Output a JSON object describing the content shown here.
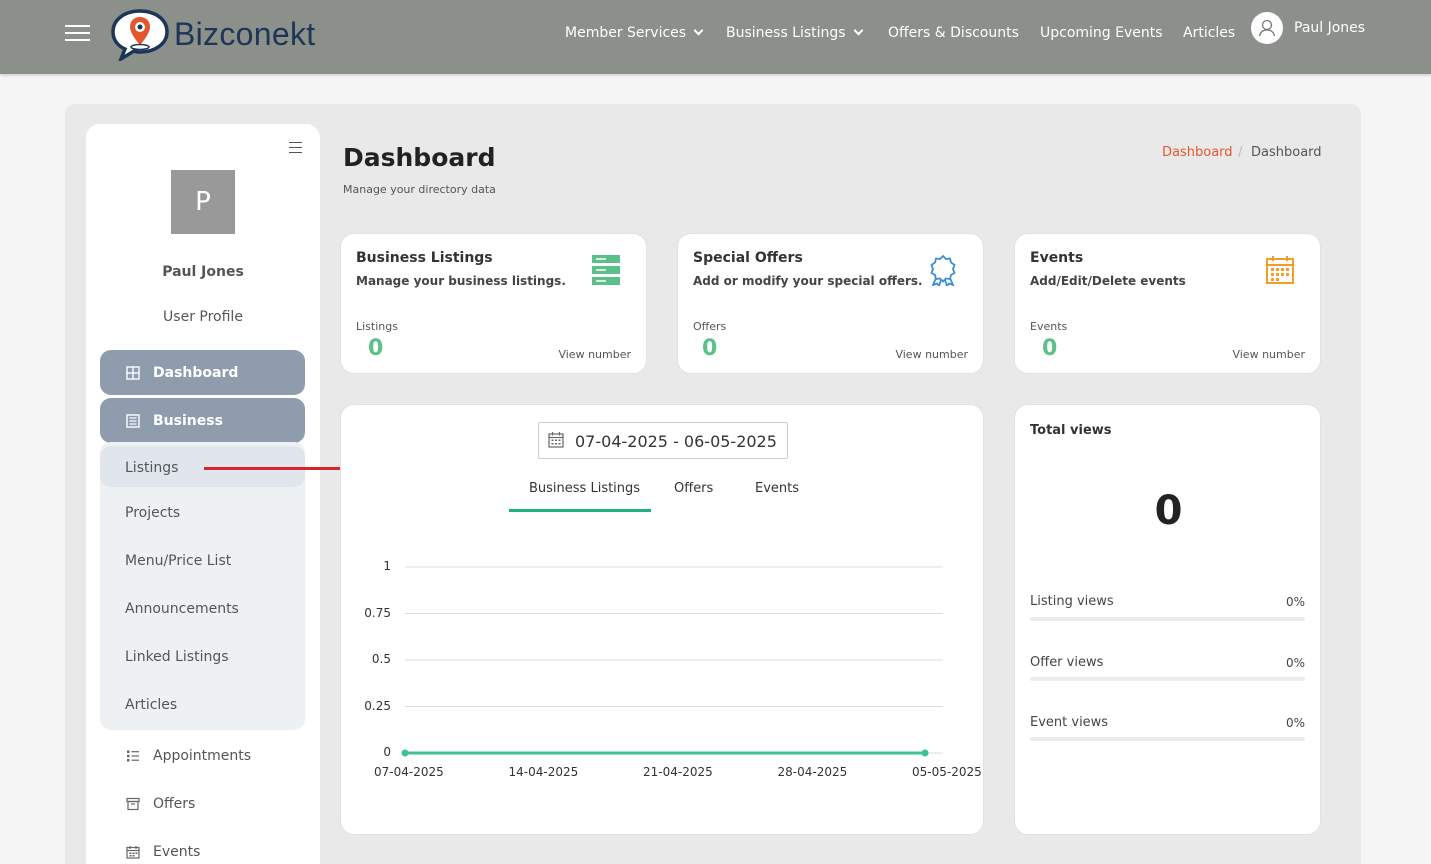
{
  "header": {
    "logo_text": "Bizconekt",
    "nav": [
      {
        "label": "Member Services",
        "dropdown": true
      },
      {
        "label": "Business Listings",
        "dropdown": true
      },
      {
        "label": "Offers & Discounts",
        "dropdown": false
      },
      {
        "label": "Upcoming Events",
        "dropdown": false
      },
      {
        "label": "Articles",
        "dropdown": false
      }
    ],
    "user_name": "Paul Jones",
    "icons": {
      "menu": "hamburger-icon",
      "user": "user-icon",
      "logo": "chat-location-pin-logo"
    }
  },
  "sidebar": {
    "avatar_letter": "P",
    "user_name": "Paul Jones",
    "profile_link": "User Profile",
    "dashboard_btn": "Dashboard",
    "business_btn": "Business",
    "business_submenu": [
      "Listings",
      "Projects",
      "Menu/Price List",
      "Announcements",
      "Linked Listings",
      "Articles"
    ],
    "active_submenu": "Listings",
    "links": [
      {
        "label": "Appointments",
        "icon": "list-icon"
      },
      {
        "label": "Offers",
        "icon": "archive-icon"
      },
      {
        "label": "Events",
        "icon": "calendar-icon"
      }
    ]
  },
  "page": {
    "title": "Dashboard",
    "subtitle": "Manage your directory data",
    "breadcrumb": {
      "link": "Dashboard",
      "separator": "/",
      "current": "Dashboard"
    }
  },
  "cards": [
    {
      "title": "Business Listings",
      "description": "Manage your business listings.",
      "label": "Listings",
      "value": "0",
      "view": "View number",
      "icon": "server-icon",
      "icon_color": "#5bc08a"
    },
    {
      "title": "Special Offers",
      "description": "Add or modify your special offers.",
      "label": "Offers",
      "value": "0",
      "view": "View number",
      "icon": "award-icon",
      "icon_color": "#3d8fd6"
    },
    {
      "title": "Events",
      "description": "Add/Edit/Delete events",
      "label": "Events",
      "value": "0",
      "view": "View number",
      "icon": "calendar-icon",
      "icon_color": "#f39c26"
    }
  ],
  "chart_panel": {
    "date_range": "07-04-2025 - 06-05-2025",
    "tabs": [
      "Business Listings",
      "Offers",
      "Events"
    ],
    "active_tab": "Business Listings"
  },
  "chart_data": {
    "type": "line",
    "x": [
      "07-04-2025",
      "05-05-2025"
    ],
    "xticks": [
      "07-04-2025",
      "14-04-2025",
      "21-04-2025",
      "28-04-2025",
      "05-05-2025"
    ],
    "yticks": [
      "1",
      "0.75",
      "0.5",
      "0.25",
      "0"
    ],
    "series": [
      {
        "values": [
          0,
          0
        ],
        "color": "#3cc29a"
      }
    ],
    "ylim": [
      0,
      1
    ],
    "grid": true
  },
  "views": {
    "title": "Total views",
    "total": "0",
    "rows": [
      {
        "label": "Listing views",
        "percent": "0%",
        "fraction": 0
      },
      {
        "label": "Offer views",
        "percent": "0%",
        "fraction": 0
      },
      {
        "label": "Event views",
        "percent": "0%",
        "fraction": 0
      }
    ]
  },
  "colors": {
    "accent": "#20b287",
    "header_bg": "#8c908b",
    "sidebar_btn": "#8e9cae",
    "breadcrumb_link": "#e4572e",
    "annotation": "#d8242f"
  }
}
